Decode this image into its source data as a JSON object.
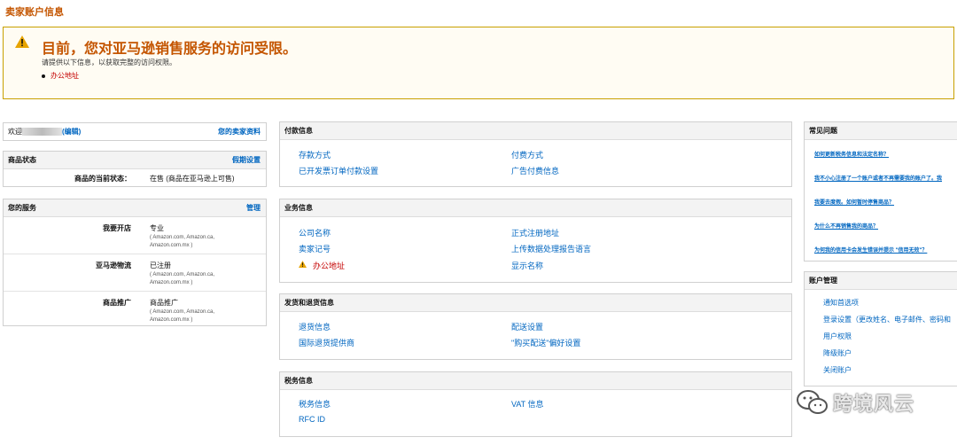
{
  "page_title": "卖家账户信息",
  "alert": {
    "heading": "目前，您对亚马逊销售服务的访问受限。",
    "text": "请提供以下信息，以获取完整的访问权限。",
    "items": [
      "办公地址"
    ]
  },
  "welcome": {
    "label": "欢迎",
    "edit": "(编辑)",
    "profile_link": "您的卖家资料"
  },
  "listing_status": {
    "title": "商品状态",
    "action": "假期设置",
    "label": "商品的当前状态：",
    "value": "在售 (商品在亚马逊上可售)"
  },
  "services": {
    "title": "您的服务",
    "action": "管理",
    "rows": [
      {
        "label": "我要开店",
        "value": "专业",
        "sub": "( Amazon.com, Amazon.ca, Amazon.com.mx )"
      },
      {
        "label": "亚马逊物流",
        "value": "已注册",
        "sub": "( Amazon.com, Amazon.ca, Amazon.com.mx )"
      },
      {
        "label": "商品推广",
        "value": "商品推广",
        "sub": "( Amazon.com, Amazon.ca, Amazon.com.mx )"
      }
    ]
  },
  "payment": {
    "title": "付款信息",
    "links": [
      "存款方式",
      "付费方式",
      "已开发票订单付款设置",
      "广告付费信息"
    ]
  },
  "business": {
    "title": "业务信息",
    "links": [
      "公司名称",
      "正式注册地址",
      "卖家记号",
      "上传数据处理报告语言",
      "办公地址",
      "显示名称"
    ]
  },
  "shipping": {
    "title": "发货和退货信息",
    "links": [
      "退货信息",
      "配送设置",
      "国际退货提供商",
      "\"购买配送\"偏好设置"
    ]
  },
  "tax": {
    "title": "税务信息",
    "links": [
      "税务信息",
      "VAT 信息",
      "RFC ID"
    ]
  },
  "faq": {
    "title": "常见问题",
    "items": [
      "如何更新税务信息和法定名称？",
      "我不小心注册了一个账户或者不再需要我的账户了。我",
      "我要去度假。如何暂时停售商品？",
      "为什么不再销售我的商品？",
      "为何我的信用卡会发生错误并提示 \"信用无效\"？"
    ]
  },
  "account_mgmt": {
    "title": "账户管理",
    "links": [
      "通知首选项",
      "登录设置（更改姓名、电子邮件、密码和",
      "用户权限",
      "降级账户",
      "关闭账户"
    ]
  },
  "watermark": {
    "text": "跨境风云"
  },
  "colors": {
    "accent": "#c45500",
    "link": "#0066c0",
    "warning": "#c40000"
  }
}
